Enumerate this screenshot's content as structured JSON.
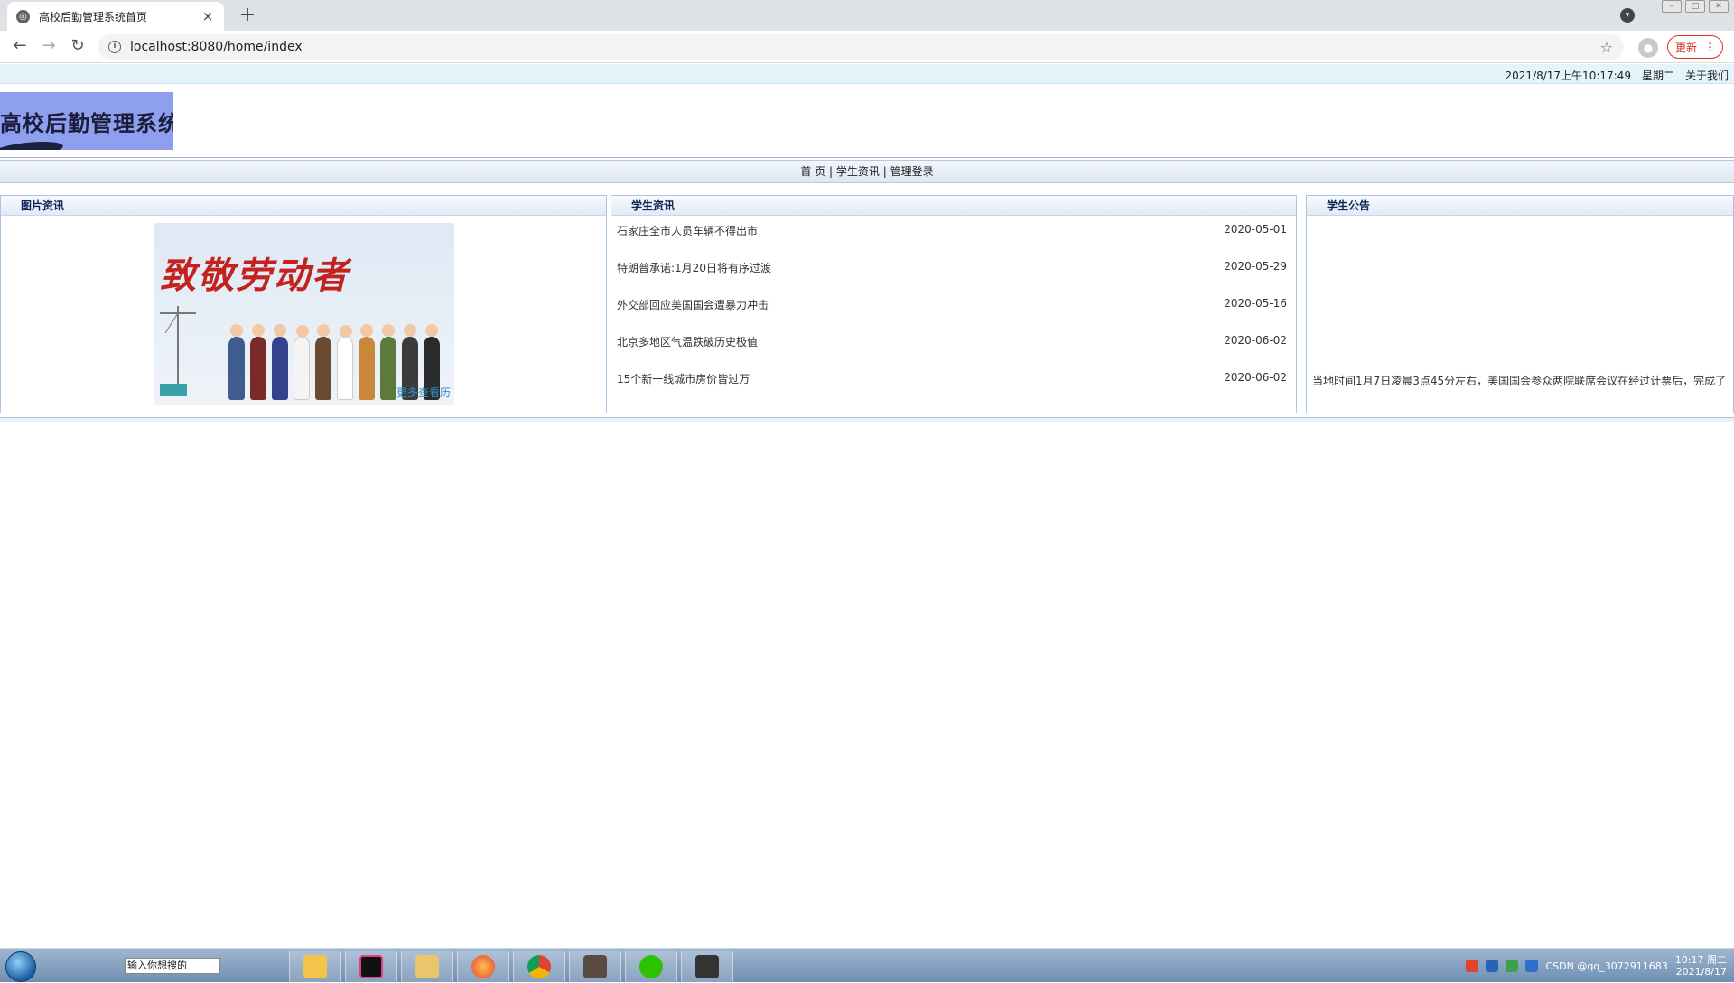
{
  "browser": {
    "tab_title": "高校后勤管理系统首页",
    "tab_close": "×",
    "new_tab": "+",
    "url": "localhost:8080/home/index",
    "update_label": "更新",
    "update_menu": "⋮",
    "back": "←",
    "forward": "→",
    "reload": "↻",
    "star": "☆"
  },
  "topbar": {
    "datetime": "2021/8/17上午10:17:49",
    "weekday": "星期二",
    "about": "关于我们"
  },
  "header": {
    "logo_text": "高校后勤管理系统"
  },
  "nav": {
    "items": [
      "首 页",
      "学生资讯",
      "管理登录"
    ],
    "separator": "|"
  },
  "panels": {
    "pictures": {
      "title": "图片资讯",
      "poster_title": "致敬劳动者",
      "poster_watermark": "更多查看历"
    },
    "news": {
      "title": "学生资讯",
      "items": [
        {
          "title": "石家庄全市人员车辆不得出市",
          "date": "2020-05-01"
        },
        {
          "title": "特朗普承诺:1月20日将有序过渡",
          "date": "2020-05-29"
        },
        {
          "title": "外交部回应美国国会遭暴力冲击",
          "date": "2020-05-16"
        },
        {
          "title": "北京多地区气温跌破历史极值",
          "date": "2020-06-02"
        },
        {
          "title": "15个新一线城市房价皆过万",
          "date": "2020-06-02"
        }
      ]
    },
    "notice": {
      "title": "学生公告",
      "text": "当地时间1月7日凌晨3点45分左右，美国国会参众两院联席会议在经过计票后，完成了"
    }
  },
  "taskbar": {
    "search_text": "输入你想搜的",
    "clock_time": "10:17 周二",
    "clock_date": "2021/8/17",
    "watermark": "CSDN @qq_3072911683"
  },
  "colors": {
    "logo_bg": "#8f9ff0",
    "topbar_bg": "#e5f4fb",
    "panel_border": "#a9c4e4",
    "panel_title": "#0d2454",
    "poster_title": "#c2231f"
  }
}
